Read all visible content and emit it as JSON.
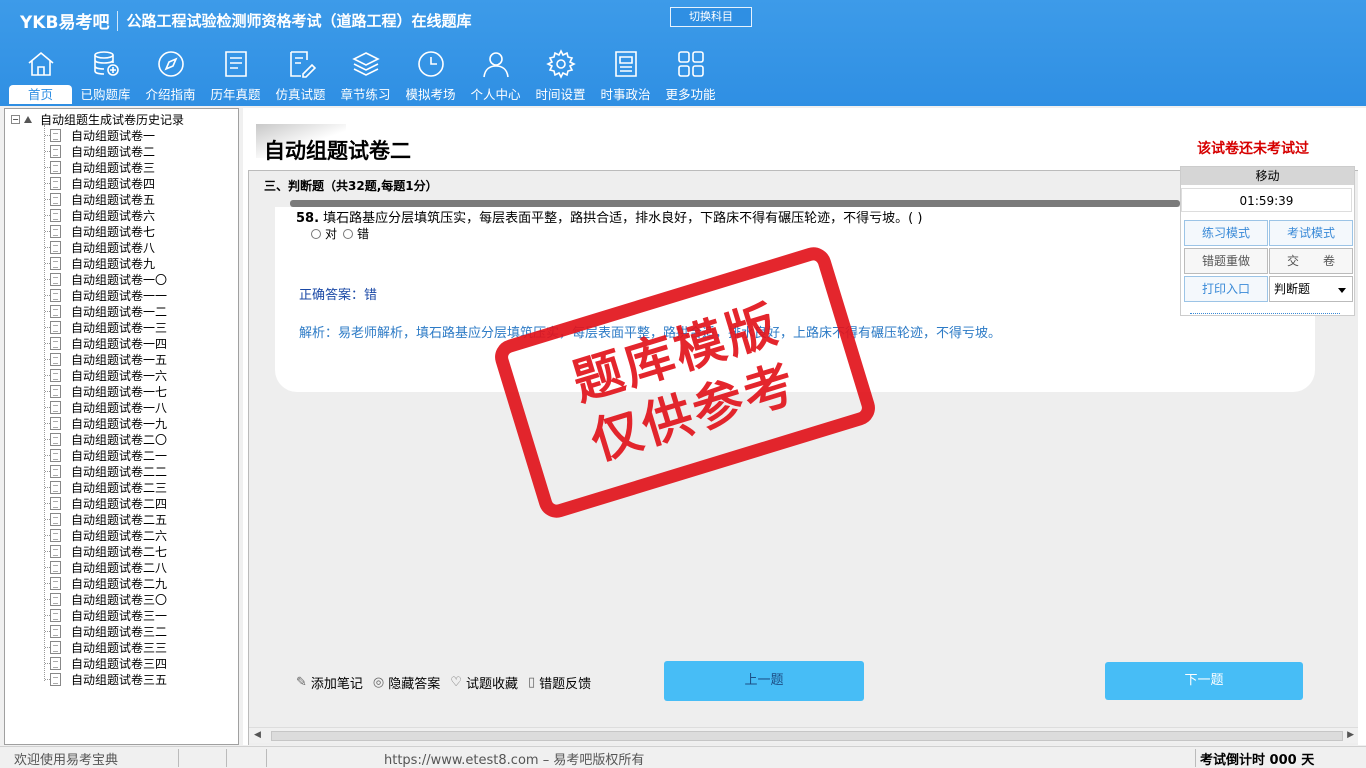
{
  "header": {
    "brand": "YKB易考吧",
    "title": "公路工程试验检测师资格考试（道路工程）在线题库",
    "switch_button": "切换科目"
  },
  "nav": [
    {
      "label": "首页",
      "icon": "home-icon",
      "active": true
    },
    {
      "label": "已购题库",
      "icon": "database-icon"
    },
    {
      "label": "介绍指南",
      "icon": "compass-icon"
    },
    {
      "label": "历年真题",
      "icon": "list-doc-icon"
    },
    {
      "label": "仿真试题",
      "icon": "edit-doc-icon"
    },
    {
      "label": "章节练习",
      "icon": "layers-icon"
    },
    {
      "label": "模拟考场",
      "icon": "clock-icon"
    },
    {
      "label": "个人中心",
      "icon": "user-icon"
    },
    {
      "label": "时间设置",
      "icon": "gear-icon"
    },
    {
      "label": "时事政治",
      "icon": "news-icon"
    },
    {
      "label": "更多功能",
      "icon": "grid-icon"
    }
  ],
  "tree": {
    "root": "自动组题生成试卷历史记录",
    "items": [
      "自动组题试卷一",
      "自动组题试卷二",
      "自动组题试卷三",
      "自动组题试卷四",
      "自动组题试卷五",
      "自动组题试卷六",
      "自动组题试卷七",
      "自动组题试卷八",
      "自动组题试卷九",
      "自动组题试卷一〇",
      "自动组题试卷一一",
      "自动组题试卷一二",
      "自动组题试卷一三",
      "自动组题试卷一四",
      "自动组题试卷一五",
      "自动组题试卷一六",
      "自动组题试卷一七",
      "自动组题试卷一八",
      "自动组题试卷一九",
      "自动组题试卷二〇",
      "自动组题试卷二一",
      "自动组题试卷二二",
      "自动组题试卷二三",
      "自动组题试卷二四",
      "自动组题试卷二五",
      "自动组题试卷二六",
      "自动组题试卷二七",
      "自动组题试卷二八",
      "自动组题试卷二九",
      "自动组题试卷三〇",
      "自动组题试卷三一",
      "自动组题试卷三二",
      "自动组题试卷三三",
      "自动组题试卷三四",
      "自动组题试卷三五"
    ]
  },
  "paper": {
    "title": "自动组题试卷二",
    "status_note": "该试卷还未考试过",
    "section": "三、判断题（共32题,每题1分）"
  },
  "question": {
    "number": "58.",
    "text": "填石路基应分层填筑压实，每层表面平整，路拱合适，排水良好，下路床不得有碾压轮迹，不得亏坡。( )",
    "options": [
      "对",
      "错"
    ],
    "answer": "正确答案：错",
    "analysis": "解析：易老师解析，填石路基应分层填筑压实，每层表面平整，路拱合适，排水良好，上路床不得有碾压轮迹，不得亏坡。"
  },
  "side_panel": {
    "header": "移动",
    "timer": "01:59:39",
    "practice_mode": "练习模式",
    "exam_mode": "考试模式",
    "redo_wrong": "错题重做",
    "submit": "交　　卷",
    "print": "打印入口",
    "question_type": "判断题"
  },
  "stamp": {
    "line1": "题库模版",
    "line2": "仅供参考"
  },
  "tools": {
    "note": "添加笔记",
    "hide_answer": "隐藏答案",
    "favorite": "试题收藏",
    "feedback": "错题反馈"
  },
  "nav_buttons": {
    "prev": "上一题",
    "next": "下一题"
  },
  "statusbar": {
    "welcome": "欢迎使用易考宝典",
    "url": "https://www.etest8.com – 易考吧版权所有",
    "countdown": "考试倒计时 000 天"
  },
  "colors": {
    "header": "#2f8fe3",
    "accent_button": "#47bdf6",
    "alert": "#d60000",
    "stamp": "#e2141c"
  }
}
